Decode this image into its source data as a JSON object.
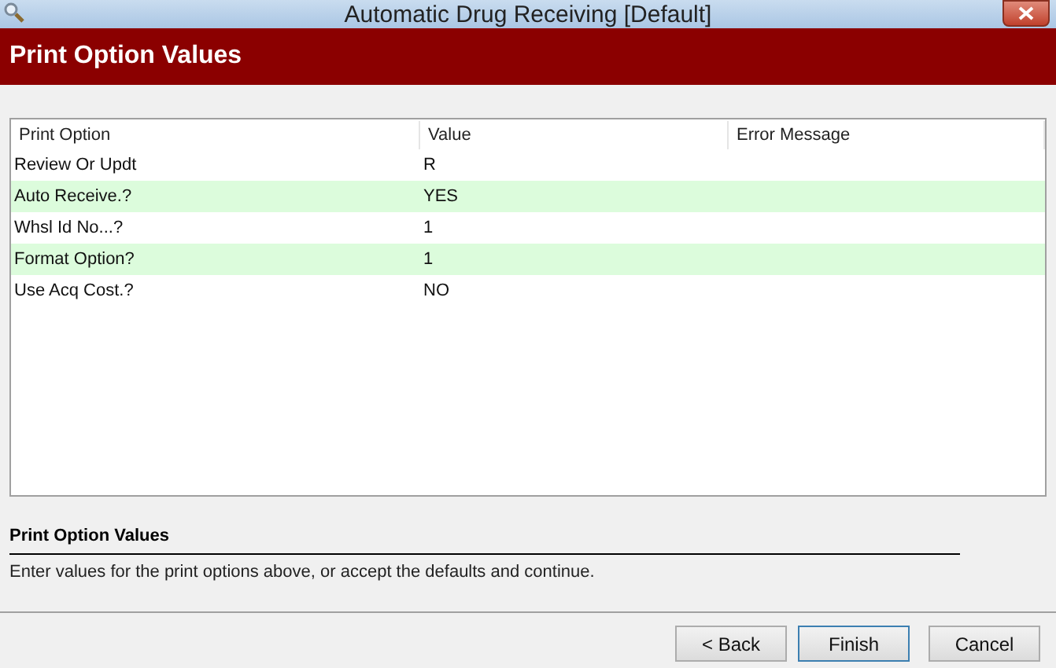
{
  "window": {
    "title": "Automatic Drug Receiving [Default]"
  },
  "banner": {
    "title": "Print Option Values"
  },
  "table": {
    "columns": [
      "Print Option",
      "Value",
      "Error Message"
    ],
    "rows": [
      {
        "option": "Review Or Updt",
        "value": "R"
      },
      {
        "option": "Auto Receive.?",
        "value": "YES"
      },
      {
        "option": "Whsl Id No...?",
        "value": "1"
      },
      {
        "option": "Format Option?",
        "value": "1"
      },
      {
        "option": "Use Acq Cost.?",
        "value": "NO"
      }
    ]
  },
  "help": {
    "title": "Print Option Values",
    "text": "Enter values for the print options above, or accept the defaults and continue."
  },
  "buttons": [
    {
      "label": "< Back",
      "focused": false
    },
    {
      "label": "Finish",
      "focused": true
    },
    {
      "label": "Cancel",
      "focused": false
    }
  ]
}
